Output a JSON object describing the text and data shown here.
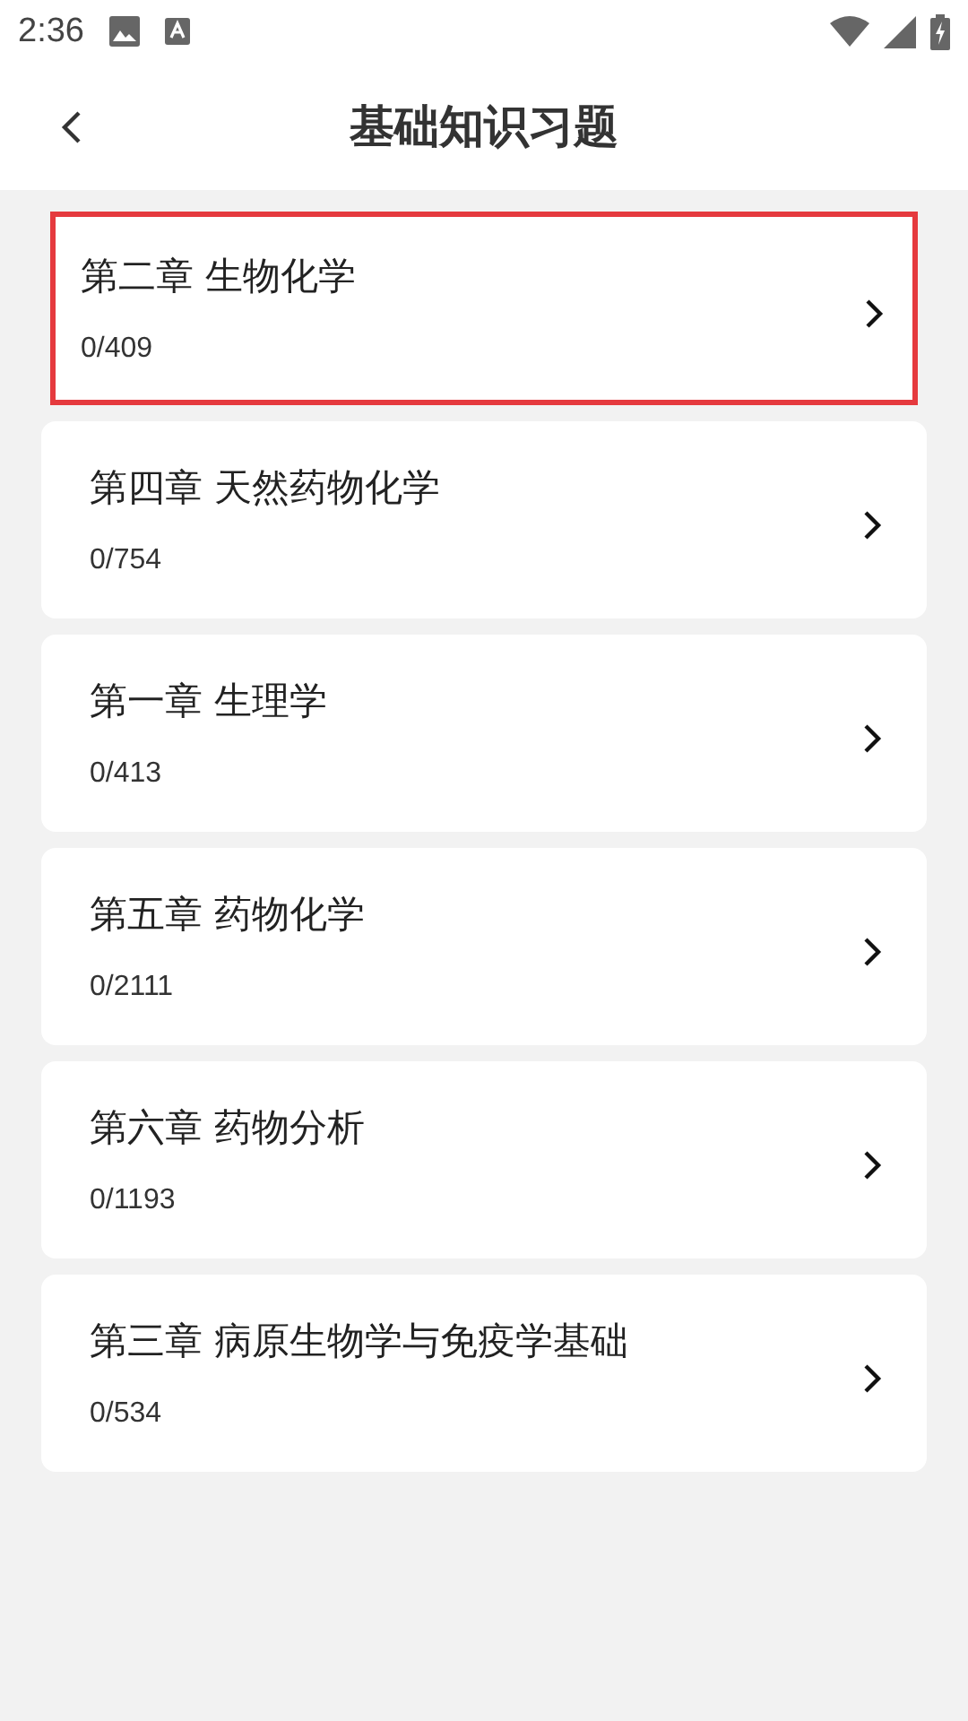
{
  "status_bar": {
    "time": "2:36"
  },
  "header": {
    "title": "基础知识习题"
  },
  "chapters": [
    {
      "title": "第二章 生物化学",
      "progress": "0/409",
      "selected": true
    },
    {
      "title": "第四章 天然药物化学",
      "progress": "0/754",
      "selected": false
    },
    {
      "title": "第一章 生理学",
      "progress": "0/413",
      "selected": false
    },
    {
      "title": "第五章 药物化学",
      "progress": "0/2111",
      "selected": false
    },
    {
      "title": "第六章 药物分析",
      "progress": "0/1193",
      "selected": false
    },
    {
      "title": "第三章 病原生物学与免疫学基础",
      "progress": "0/534",
      "selected": false
    }
  ]
}
